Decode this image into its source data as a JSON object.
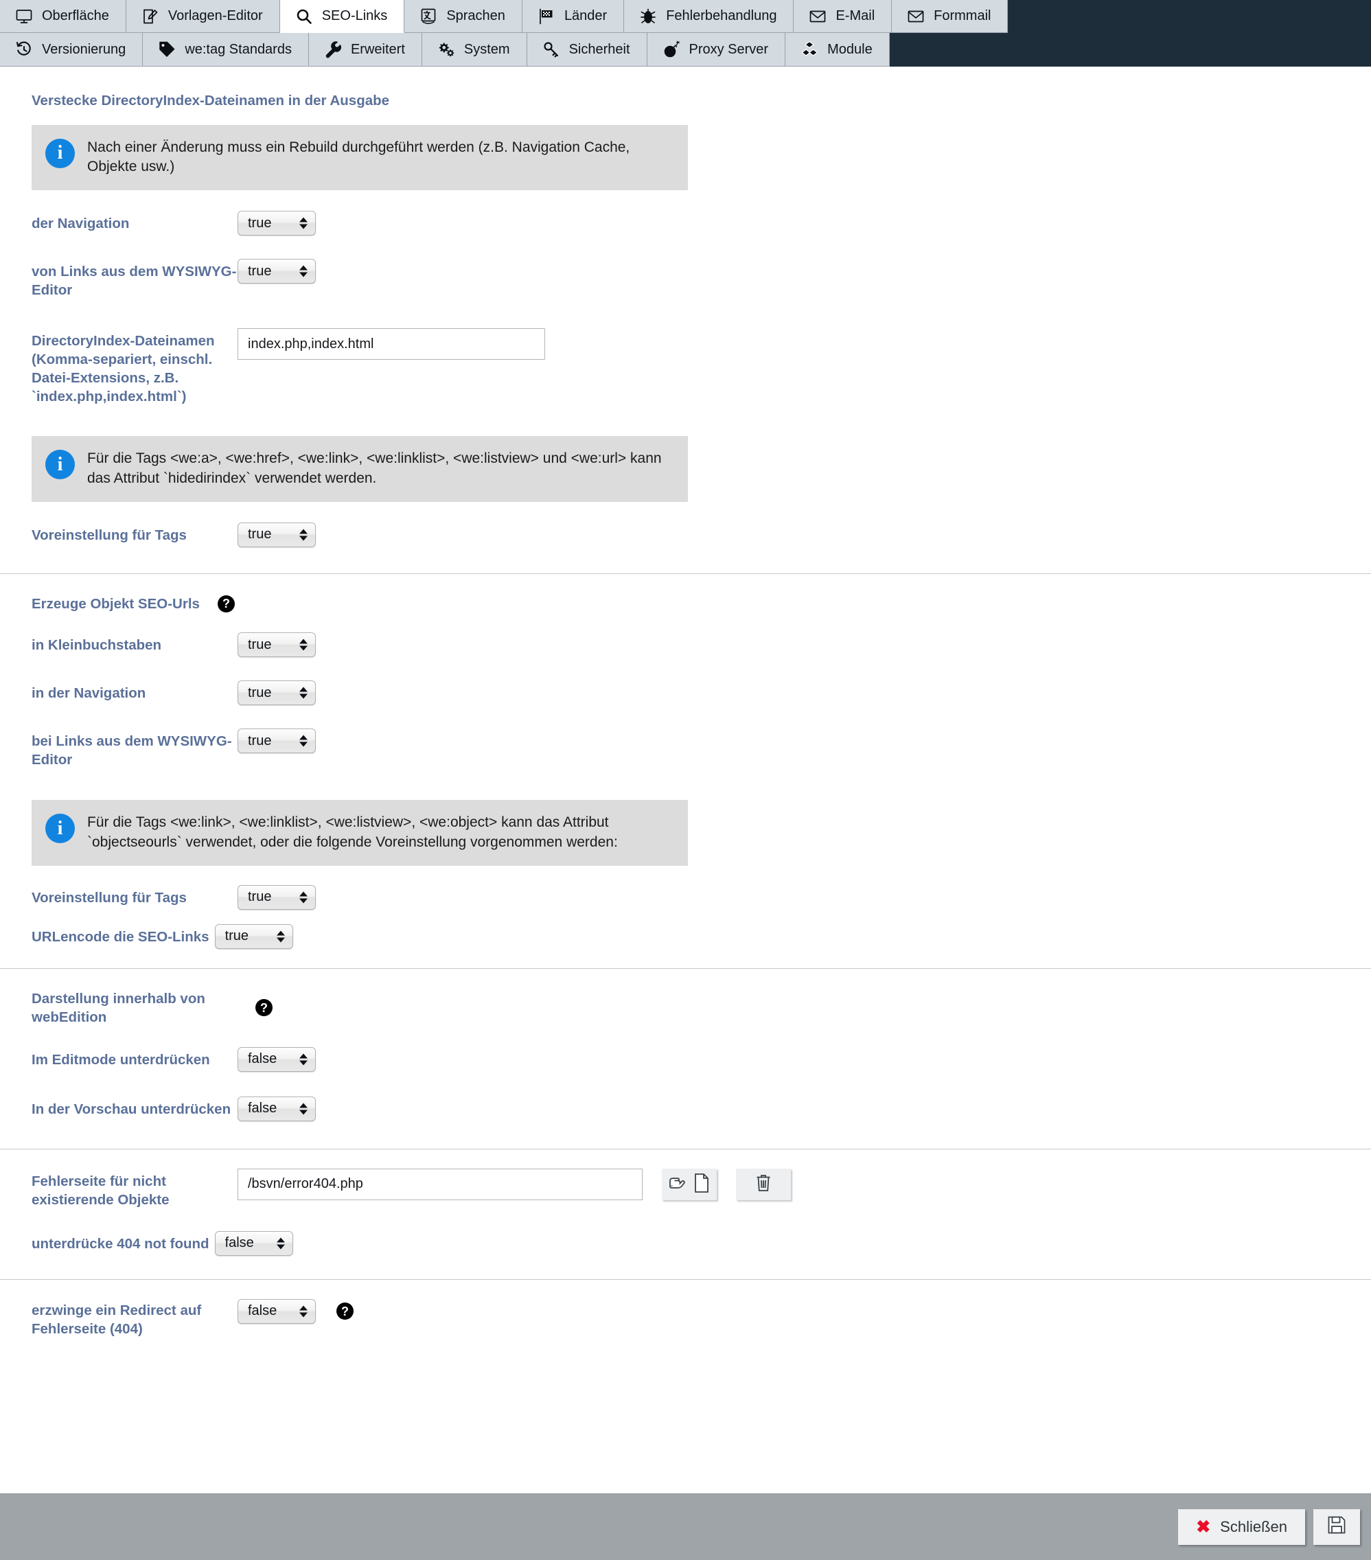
{
  "tabs": {
    "row1": [
      {
        "label": "Oberfläche",
        "icon": "monitor-icon",
        "active": false
      },
      {
        "label": "Vorlagen-Editor",
        "icon": "edit-document-icon",
        "active": false
      },
      {
        "label": "SEO-Links",
        "icon": "search-icon",
        "active": true
      },
      {
        "label": "Sprachen",
        "icon": "translate-icon",
        "active": false
      },
      {
        "label": "Länder",
        "icon": "flag-icon",
        "active": false
      },
      {
        "label": "Fehlerbehandlung",
        "icon": "bug-icon",
        "active": false
      },
      {
        "label": "E-Mail",
        "icon": "envelope-icon",
        "active": false
      },
      {
        "label": "Formmail",
        "icon": "envelope-icon",
        "active": false
      }
    ],
    "row2": [
      {
        "label": "Versionierung",
        "icon": "history-icon",
        "active": false
      },
      {
        "label": "we:tag Standards",
        "icon": "tag-icon",
        "active": false
      },
      {
        "label": "Erweitert",
        "icon": "wrench-icon",
        "active": false
      },
      {
        "label": "System",
        "icon": "gears-icon",
        "active": false
      },
      {
        "label": "Sicherheit",
        "icon": "key-icon",
        "active": false
      },
      {
        "label": "Proxy Server",
        "icon": "bomb-icon",
        "active": false
      },
      {
        "label": "Module",
        "icon": "blocks-icon",
        "active": false
      }
    ]
  },
  "main": {
    "section1": {
      "title": "Verstecke DirectoryIndex-Dateinamen in der Ausgabe",
      "info": "Nach einer Änderung muss ein Rebuild durchgeführt werden (z.B. Navigation Cache, Objekte usw.)",
      "rows": [
        {
          "label": "der Navigation",
          "value": "true"
        },
        {
          "label": "von Links aus dem WYSIWYG-Editor",
          "value": "true"
        }
      ],
      "dirindex": {
        "label": "DirectoryIndex-Dateinamen (Komma-separiert, einschl. Datei-Extensions, z.B. `index.php,index.html`)",
        "value": "index.php,index.html"
      },
      "info2": "Für die Tags <we:a>, <we:href>, <we:link>, <we:linklist>, <we:listview> und <we:url> kann das Attribut `hidedirindex` verwendet werden.",
      "tagdefault": {
        "label": "Voreinstellung für Tags",
        "value": "true"
      }
    },
    "section2": {
      "title": "Erzeuge Objekt SEO-Urls",
      "help": "?",
      "rows": [
        {
          "label": "in Kleinbuchstaben",
          "value": "true"
        },
        {
          "label": "in der Navigation",
          "value": "true"
        },
        {
          "label": "bei Links aus dem WYSIWYG-Editor",
          "value": "true"
        }
      ],
      "info": "Für die Tags <we:link>, <we:linklist>, <we:listview>, <we:object> kann das Attribut `objectseourls` verwendet, oder die folgende Voreinstellung vorgenommen werden:",
      "tagdefault": {
        "label": "Voreinstellung für Tags",
        "value": "true"
      },
      "urlencode": {
        "label": "URLencode die SEO-Links",
        "value": "true"
      }
    },
    "section3": {
      "title": "Darstellung innerhalb von webEdition",
      "help": "?",
      "rows": [
        {
          "label": "Im Editmode unterdrücken",
          "value": "false"
        },
        {
          "label": "In der Vorschau unterdrücken",
          "value": "false"
        }
      ]
    },
    "section4": {
      "errorpage": {
        "label": "Fehlerseite für nicht existierende Objekte",
        "value": "/bsvn/error404.php",
        "select_button": "select-document-button",
        "delete_button": "delete-button"
      },
      "suppress404": {
        "label": "unterdrücke 404 not found",
        "value": "false"
      },
      "forceredirect": {
        "label": "erzwinge ein Redirect auf Fehlerseite (404)",
        "value": "false",
        "help": "?"
      }
    }
  },
  "footer": {
    "close_label": "Schließen",
    "save_icon": "save-floppy-icon"
  },
  "colors": {
    "label_blue": "#5a7099",
    "header_dark": "#1d2d3a",
    "tab_bg": "#d3dae0",
    "info_bg": "#dcdcdc",
    "info_icon": "#1184e0",
    "footer_bg": "#9fa4a8",
    "close_x": "#e8102a"
  }
}
